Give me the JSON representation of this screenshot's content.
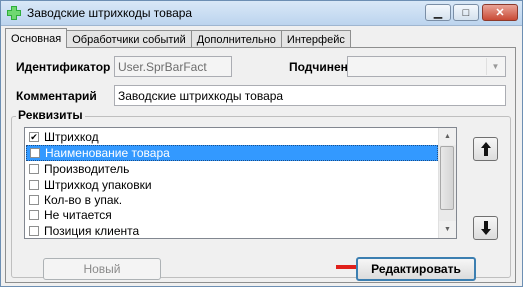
{
  "window": {
    "title": "Заводские штрихкоды товара"
  },
  "tabs": [
    {
      "label": "Основная",
      "active": true
    },
    {
      "label": "Обработчики событий",
      "active": false
    },
    {
      "label": "Дополнительно",
      "active": false
    },
    {
      "label": "Интерфейс",
      "active": false
    }
  ],
  "form": {
    "identifier_label": "Идентификатор",
    "identifier_value": "User.SprBarFact",
    "subordinate_label": "Подчинен",
    "subordinate_value": "",
    "comment_label": "Комментарий",
    "comment_value": "Заводские штрихкоды товара"
  },
  "requisites": {
    "title": "Реквизиты",
    "items": [
      {
        "label": "Штрихкод",
        "checked": true,
        "selected": false
      },
      {
        "label": "Наименование товара",
        "checked": false,
        "selected": true
      },
      {
        "label": "Производитель",
        "checked": false,
        "selected": false
      },
      {
        "label": "Штрихкод упаковки",
        "checked": false,
        "selected": false
      },
      {
        "label": "Кол-во в упак.",
        "checked": false,
        "selected": false
      },
      {
        "label": "Не читается",
        "checked": false,
        "selected": false
      },
      {
        "label": "Позиция клиента",
        "checked": false,
        "selected": false
      }
    ]
  },
  "buttons": {
    "new_label": "Новый",
    "edit_label": "Редактировать"
  },
  "colors": {
    "selection": "#3399ff",
    "accent_arrow": "#e0201b",
    "titlebar": "#bcd4ee"
  }
}
